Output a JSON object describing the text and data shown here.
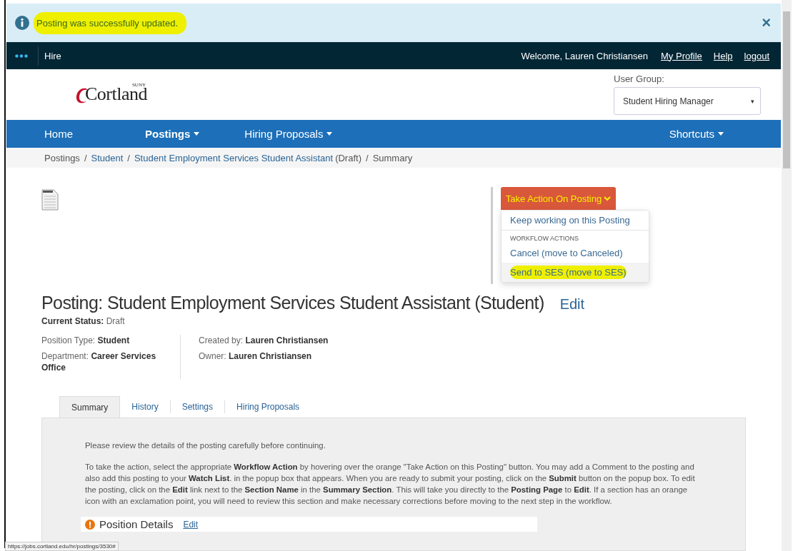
{
  "alert": {
    "text": "Posting was successfully updated.",
    "highlighted": true,
    "close": "×"
  },
  "topbar": {
    "app": "Hire",
    "welcome": "Welcome, Lauren Christiansen",
    "links": [
      "My Profile",
      "Help",
      "logout"
    ]
  },
  "logo": {
    "superscript": "SUNY",
    "name": "Cortland"
  },
  "user_group": {
    "label": "User Group:",
    "value": "Student Hiring Manager",
    "caret": "▾"
  },
  "nav": {
    "items": [
      {
        "label": "Home",
        "dropdown": false,
        "selected": false
      },
      {
        "label": "Postings",
        "dropdown": true,
        "selected": true
      },
      {
        "label": "Hiring Proposals",
        "dropdown": true,
        "selected": false
      }
    ],
    "shortcuts": {
      "label": "Shortcuts",
      "dropdown": true
    }
  },
  "breadcrumb": {
    "separator": "/",
    "items": [
      {
        "label": "Postings",
        "link": false
      },
      {
        "label": "Student",
        "link": true
      },
      {
        "label": "Student Employment Services Student Assistant",
        "link": true,
        "note": "(Draft)"
      },
      {
        "label": "Summary",
        "link": false
      }
    ]
  },
  "action_menu": {
    "button": "Take Action On Posting",
    "button_highlighted": true,
    "expanded": true,
    "items": [
      {
        "kind": "item",
        "label": "Keep working on this Posting",
        "hovered": false,
        "highlighted": false
      },
      {
        "kind": "header",
        "label": "WORKFLOW ACTIONS"
      },
      {
        "kind": "item",
        "label": "Cancel (move to Canceled)",
        "hovered": false,
        "highlighted": false
      },
      {
        "kind": "item",
        "label": "Send to SES (move to SES)",
        "hovered": true,
        "highlighted": true
      }
    ]
  },
  "posting": {
    "title": "Posting: Student Employment Services Student Assistant (Student)",
    "edit": "Edit",
    "status_label": "Current Status:",
    "status": "Draft",
    "meta_left": [
      {
        "label": "Position Type:",
        "value": "Student"
      },
      {
        "label": "Department:",
        "value": "Career Services Office"
      }
    ],
    "meta_right": [
      {
        "label": "Created by:",
        "value": "Lauren Christiansen"
      },
      {
        "label": "Owner:",
        "value": "Lauren Christiansen"
      }
    ]
  },
  "tabs": [
    {
      "label": "Summary",
      "selected": true
    },
    {
      "label": "History",
      "selected": false
    },
    {
      "label": "Settings",
      "selected": false
    },
    {
      "label": "Hiring Proposals",
      "selected": false
    }
  ],
  "panel": {
    "paragraphs": [
      "Please review the details of the posting carefully before continuing.",
      "To take the action, select the appropriate **Workflow Action** by hovering over the orange \"Take Action on this Posting\" button. You may add a Comment to the posting and also add this posting to your **Watch List**. in the popup box that appears. When you are ready to submit your posting, click on the **Submit** button on the popup box. To edit the posting, click on the **Edit** link next to the **Section Name** in the **Summary Section**. This will take you directly to the **Posting Page** to **Edit**. If a section has an orange icon with an exclamation point, you will need to review this section and make necessary corrections before moving to the next step in the workflow."
    ],
    "section": {
      "title": "Position Details",
      "edit": "Edit",
      "warning": true
    }
  },
  "status_url": "https://jobs.cortland.edu/hr/postings/3530#"
}
